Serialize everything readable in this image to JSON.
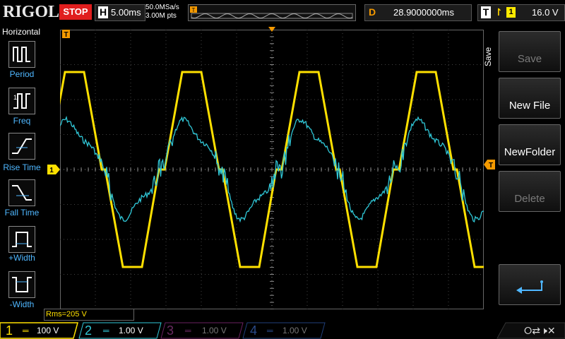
{
  "topbar": {
    "logo": "RIGOL",
    "run_state": "STOP",
    "horizontal_label": "H",
    "timebase": "5.00ms",
    "sample_rate": "50.0MSa/s",
    "memory_depth": "3.00M pts",
    "delay_label": "D",
    "delay_value": "28.9000000ms",
    "trigger_label": "T",
    "trigger_source": "1",
    "trigger_level": "16.0 V"
  },
  "left_panel": {
    "title": "Horizontal",
    "items": [
      {
        "label": "Period",
        "icon": "period-icon"
      },
      {
        "label": "Freq",
        "icon": "frequency-icon"
      },
      {
        "label": "Rise Time",
        "icon": "rise-time-icon"
      },
      {
        "label": "Fall Time",
        "icon": "fall-time-icon"
      },
      {
        "label": "+Width",
        "icon": "positive-width-icon"
      },
      {
        "label": "-Width",
        "icon": "negative-width-icon"
      }
    ]
  },
  "right_panel": {
    "title": "Save",
    "buttons": [
      {
        "label": "Save",
        "enabled": false
      },
      {
        "label": "New File",
        "enabled": true
      },
      {
        "label": "NewFolder",
        "enabled": true
      },
      {
        "label": "Delete",
        "enabled": false
      },
      {
        "label": "",
        "icon": "return-icon",
        "enabled": true
      }
    ]
  },
  "measurement": {
    "text": "Rms=205 V"
  },
  "channels": [
    {
      "number": "1",
      "scale": "100 V",
      "color": "#ffe000",
      "active": true
    },
    {
      "number": "2",
      "scale": "1.00 V",
      "color": "#30c8d8",
      "active": true
    },
    {
      "number": "3",
      "scale": "1.00 V",
      "color": "#d030c0",
      "active": false
    },
    {
      "number": "4",
      "scale": "1.00 V",
      "color": "#3070ff",
      "active": false
    }
  ],
  "markers": {
    "ch1_ground_label": "1",
    "trigger_marker_label": "T"
  },
  "colors": {
    "ch1": "#ffe000",
    "ch2": "#30c8d8",
    "stop": "#e01e1e",
    "accent_orange": "#f59a00",
    "label_blue": "#4fb7ff"
  }
}
